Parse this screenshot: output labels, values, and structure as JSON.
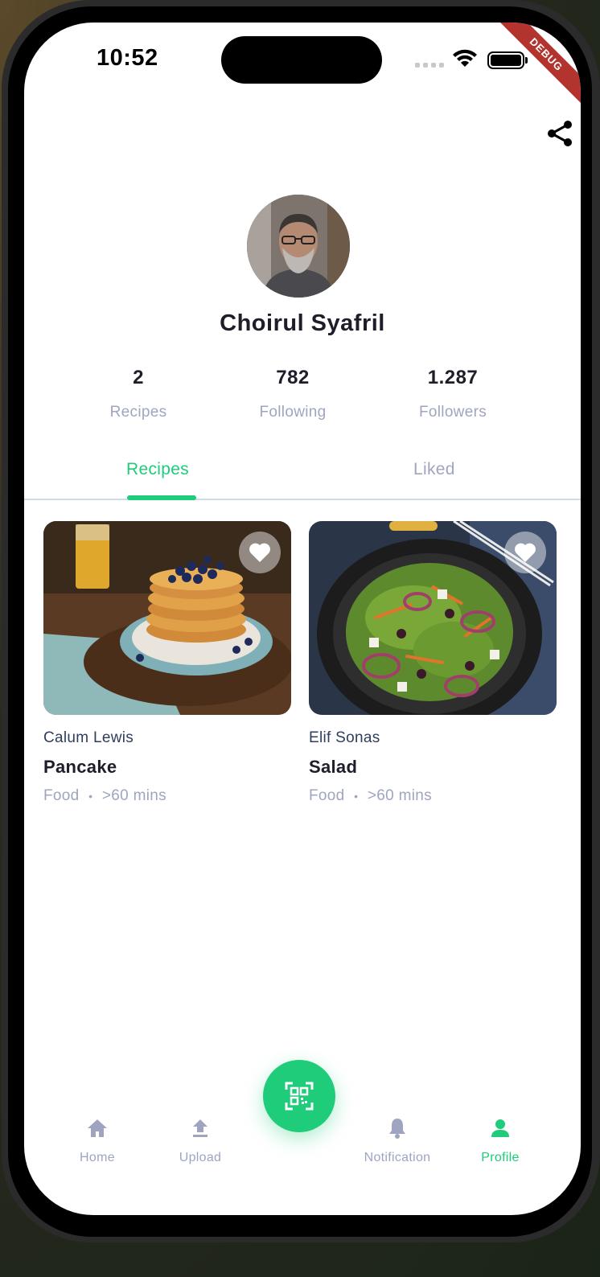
{
  "status_bar": {
    "time": "10:52",
    "debug_label": "DEBUG"
  },
  "profile": {
    "name": "Choirul Syafril",
    "stats": [
      {
        "value": "2",
        "label": "Recipes"
      },
      {
        "value": "782",
        "label": "Following"
      },
      {
        "value": "1.287",
        "label": "Followers"
      }
    ]
  },
  "tabs": [
    {
      "label": "Recipes",
      "active": true
    },
    {
      "label": "Liked",
      "active": false
    }
  ],
  "recipes": [
    {
      "author": "Calum Lewis",
      "title": "Pancake",
      "category": "Food",
      "separator": "•",
      "duration": ">60 mins"
    },
    {
      "author": "Elif Sonas",
      "title": "Salad",
      "category": "Food",
      "separator": "•",
      "duration": ">60 mins"
    }
  ],
  "bottom_nav": [
    {
      "label": "Home",
      "icon": "home-icon",
      "active": false
    },
    {
      "label": "Upload",
      "icon": "upload-icon",
      "active": false
    },
    {
      "label": "Notification",
      "icon": "bell-icon",
      "active": false
    },
    {
      "label": "Profile",
      "icon": "person-icon",
      "active": true
    }
  ],
  "fab": {
    "icon": "qr-scan-icon"
  },
  "colors": {
    "accent": "#1FCC79",
    "inactive": "#9FA5C0",
    "text_dark": "#1E1E2B",
    "debug_banner": "#B3342F"
  }
}
